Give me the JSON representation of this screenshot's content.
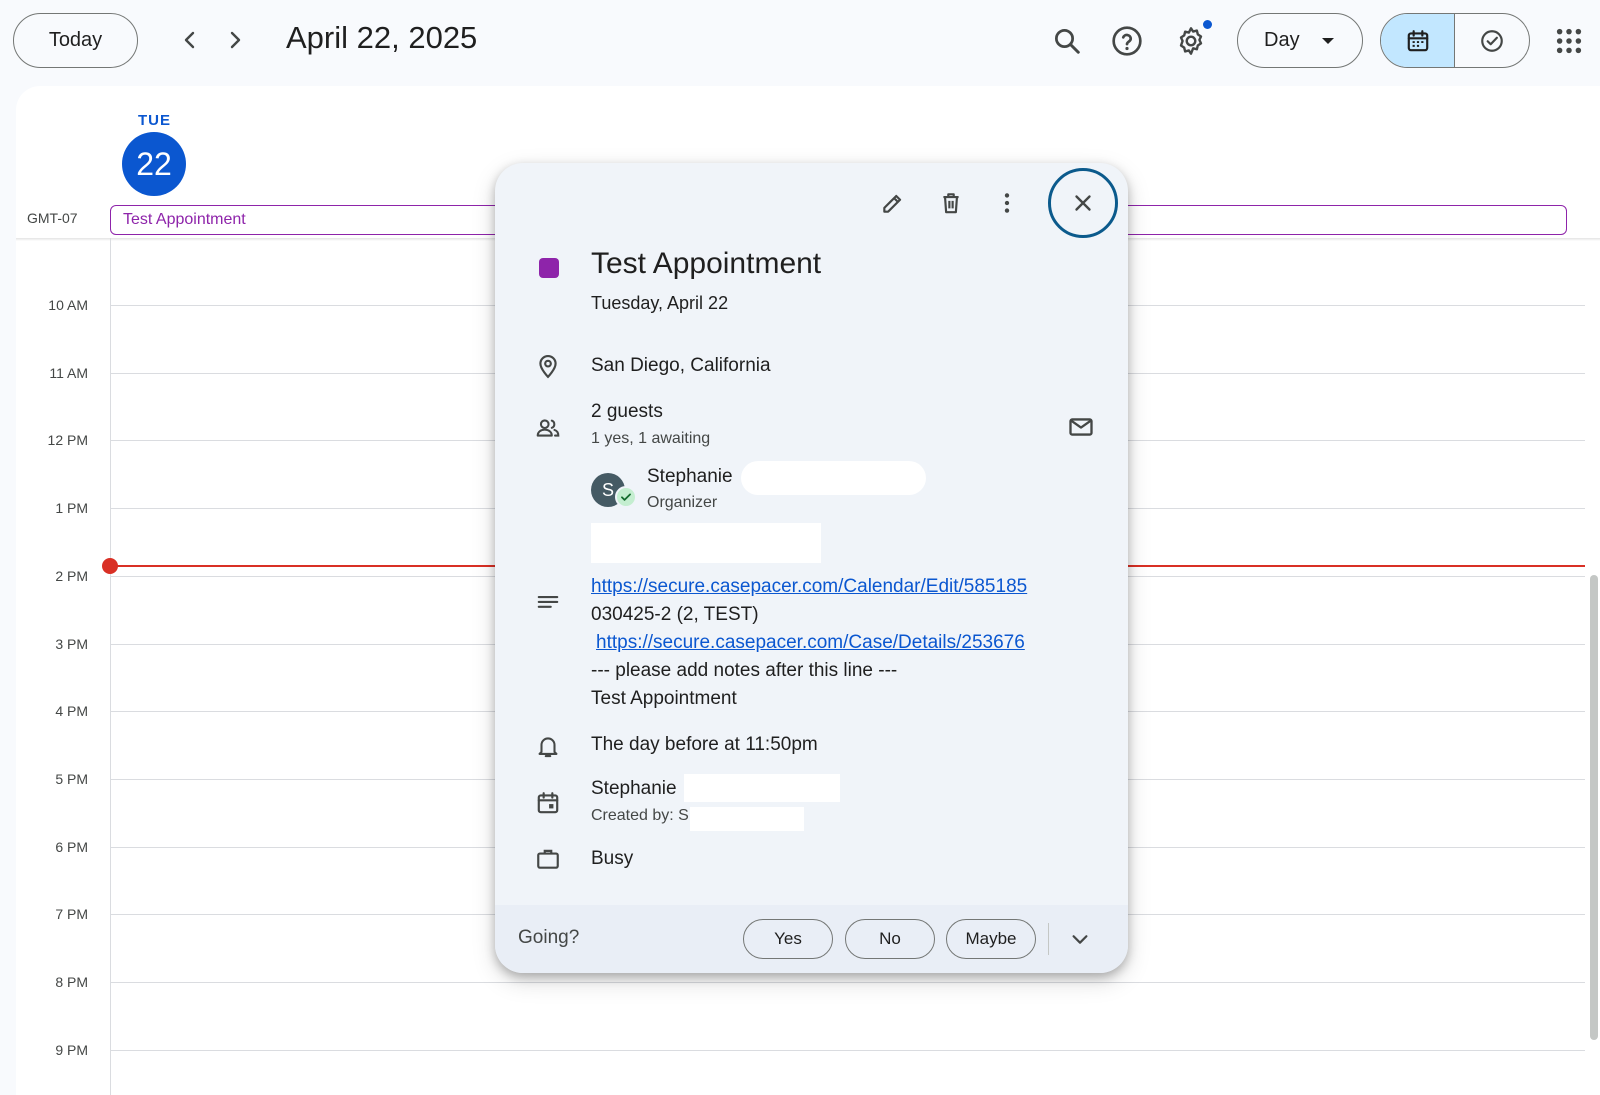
{
  "toolbar": {
    "today_label": "Today",
    "date_title": "April 22, 2025",
    "view_label": "Day"
  },
  "day_header": {
    "weekday": "TUE",
    "day_number": "22",
    "timezone": "GMT-07"
  },
  "all_day_event": "Test Appointment",
  "hours": [
    "10 AM",
    "11 AM",
    "12 PM",
    "1 PM",
    "2 PM",
    "3 PM",
    "4 PM",
    "5 PM",
    "6 PM",
    "7 PM",
    "8 PM",
    "9 PM"
  ],
  "popup": {
    "title": "Test Appointment",
    "date": "Tuesday, April 22",
    "location": "San Diego, California",
    "guests_count": "2 guests",
    "guests_status": "1 yes, 1 awaiting",
    "organizer_initial": "S",
    "organizer_name": "Stephanie",
    "organizer_role": "Organizer",
    "description_link1": "https://secure.casepacer.com/Calendar/Edit/585185",
    "description_line2": "030425-2 (2, TEST)",
    "description_link2": "https://secure.casepacer.com/Case/Details/253676",
    "description_line4": "--- please add notes after this line ---",
    "description_line5": "Test Appointment",
    "reminder": "The day before at 11:50pm",
    "calendar_owner": "Stephanie",
    "created_by": "Created by: S",
    "availability": "Busy",
    "going_label": "Going?",
    "rsvp_yes": "Yes",
    "rsvp_no": "No",
    "rsvp_maybe": "Maybe"
  },
  "colors": {
    "accent": "#0b57d0",
    "event": "#8e24aa",
    "now_line": "#d93025",
    "popup_bg": "#f0f4f9"
  },
  "icons": [
    "chevron-left-icon",
    "chevron-right-icon",
    "search-icon",
    "help-icon",
    "gear-icon",
    "calendar-icon",
    "task-check-icon",
    "apps-grid-icon",
    "pencil-icon",
    "trash-icon",
    "more-vert-icon",
    "close-icon",
    "location-pin-icon",
    "people-icon",
    "mail-icon",
    "notes-icon",
    "bell-icon",
    "calendar-event-icon",
    "briefcase-icon",
    "chevron-down-icon"
  ]
}
